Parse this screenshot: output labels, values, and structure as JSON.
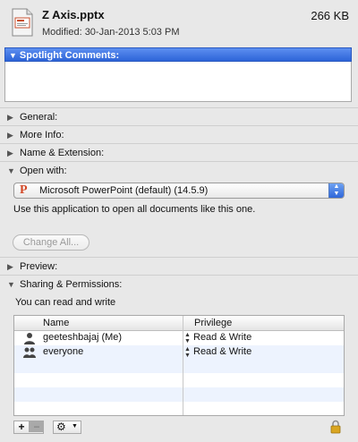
{
  "header": {
    "file_name": "Z Axis.pptx",
    "file_size": "266 KB",
    "modified": "Modified: 30-Jan-2013 5:03 PM"
  },
  "spotlight": {
    "label": "Spotlight Comments:",
    "value": ""
  },
  "sections": {
    "general": "General:",
    "more_info": "More Info:",
    "name_extension": "Name & Extension:",
    "open_with": "Open with:",
    "preview": "Preview:",
    "sharing": "Sharing & Permissions:"
  },
  "open_with": {
    "app": "Microsoft PowerPoint (default) (14.5.9)",
    "note": "Use this application to open all documents like this one.",
    "change_all": "Change All..."
  },
  "permissions": {
    "summary": "You can read and write",
    "columns": {
      "name": "Name",
      "privilege": "Privilege"
    },
    "rows": [
      {
        "name": "geeteshbajaj (Me)",
        "privilege": "Read & Write"
      },
      {
        "name": "everyone",
        "privilege": "Read & Write"
      }
    ]
  },
  "colors": {
    "selection_blue": "#2d64d8",
    "alt_row": "#edf3fe",
    "powerpoint": "#d24726"
  },
  "icons": [
    "pptx-file-icon",
    "triangle-icon",
    "powerpoint-icon",
    "user-icon",
    "group-icon",
    "gear-icon",
    "lock-icon"
  ]
}
